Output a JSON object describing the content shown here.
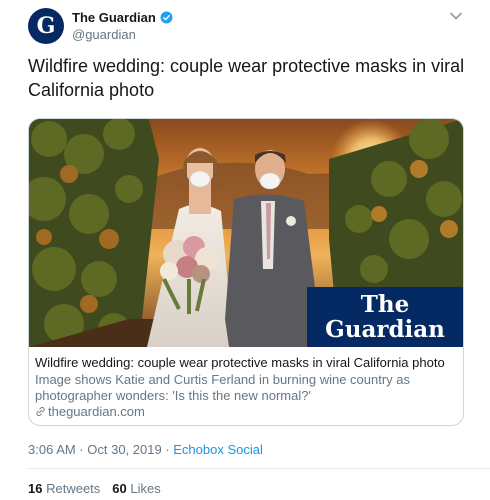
{
  "account": {
    "avatar_letter": "G",
    "display_name": "The Guardian",
    "handle": "@guardian",
    "verified": true
  },
  "tweet": {
    "text": "Wildfire wedding: couple wear protective masks in viral California photo",
    "timestamp": "3:06 AM · Oct 30, 2019",
    "separator": " · ",
    "source": "Echobox Social"
  },
  "card": {
    "logo_line1": "The",
    "logo_line2": "Guardian",
    "title": "Wildfire wedding: couple wear protective masks in viral California photo",
    "description": "Image shows Katie and Curtis Ferland in burning wine country as photographer wonders:   'Is this the new normal?'",
    "domain": "theguardian.com"
  },
  "stats": {
    "retweets_count": "16",
    "retweets_label": "Retweets",
    "likes_count": "60",
    "likes_label": "Likes"
  },
  "colors": {
    "guardian_blue": "#052962",
    "link_blue": "#1b95e0",
    "secondary_text": "#657786",
    "border": "#ccd6dd"
  },
  "icons": [
    "verified-icon",
    "chevron-down-icon",
    "link-icon"
  ]
}
